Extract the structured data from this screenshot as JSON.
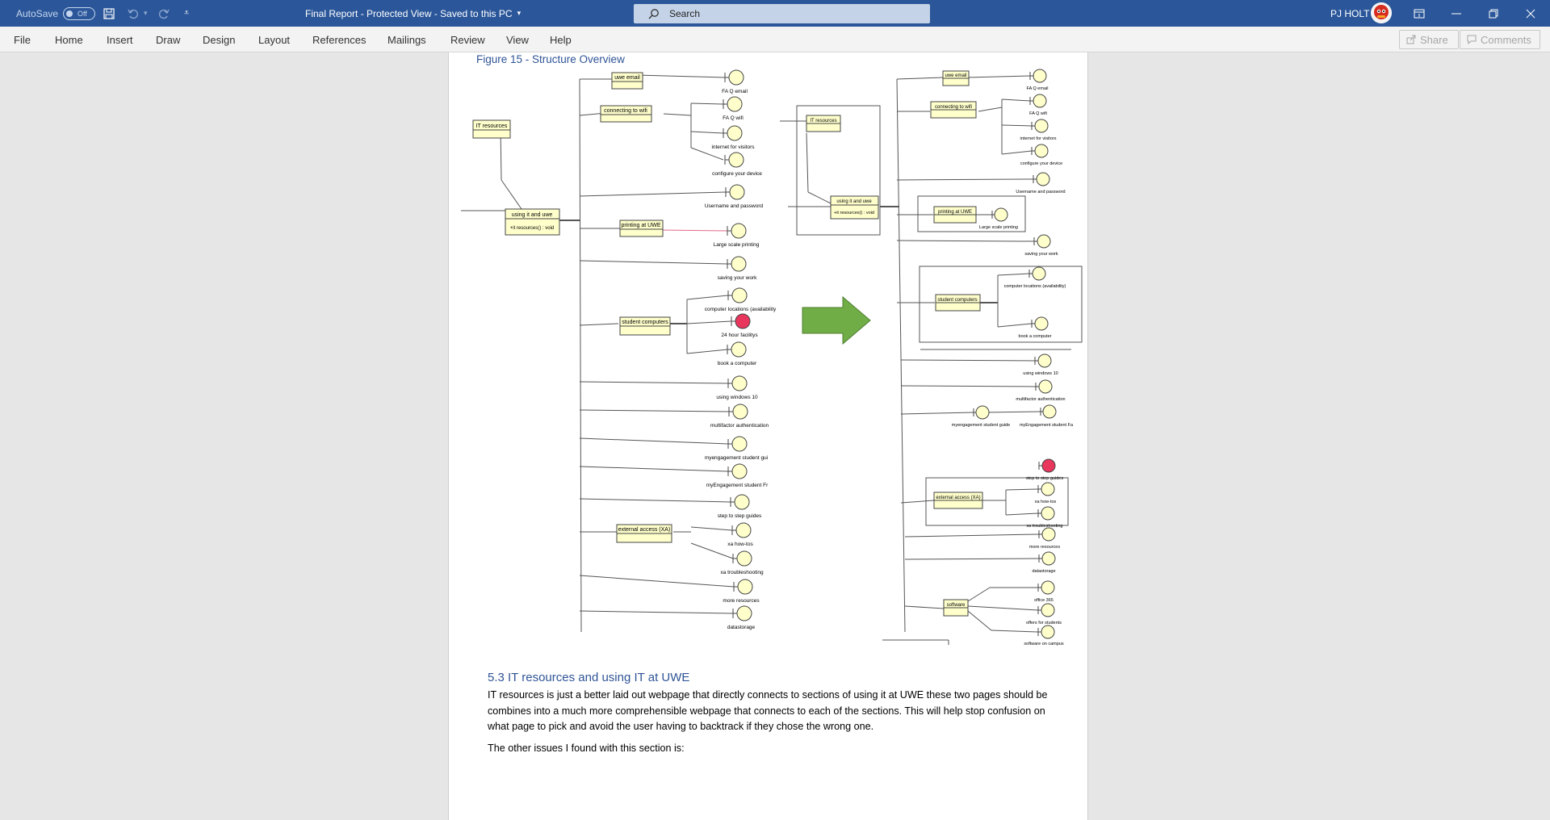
{
  "titlebar": {
    "autosave_label": "AutoSave",
    "autosave_state": "Off",
    "doc_title": "Final Report  -  Protected View  -  Saved to this PC",
    "search_placeholder": "Search",
    "user_name": "PJ HOLT"
  },
  "ribbon": {
    "tabs": [
      "File",
      "Home",
      "Insert",
      "Draw",
      "Design",
      "Layout",
      "References",
      "Mailings",
      "Review",
      "View",
      "Help"
    ],
    "share_label": "Share",
    "comments_label": "Comments"
  },
  "document": {
    "figure_caption": "Figure 15 - Structure Overview",
    "section_heading": "5.3 IT resources and using IT at UWE",
    "paragraph": "IT resources is just a better laid out webpage that directly connects to sections of using it at UWE these two pages should be combines into a much more comprehensible webpage that connects to each of the sections. This will help stop confusion on what page to pick and avoid the user having to backtrack if they chose the wrong one.",
    "paragraph2": "The other issues I found with this section is:"
  },
  "diagram_left": {
    "classes": [
      {
        "label": "uwe email"
      },
      {
        "label": "connecting to  wifi"
      },
      {
        "label": "IT resources"
      },
      {
        "label": "using it and uwe",
        "method": "+it resources() : void"
      },
      {
        "label": "printing at UWE"
      },
      {
        "label": "student computers"
      },
      {
        "label": "external access (XA)"
      }
    ],
    "nodes": [
      "FA Q email",
      "FA Q wifi",
      "internet for visitors",
      "configure your device",
      "Username and password",
      "Large scale printing",
      "saving your work",
      "computer locations (availability",
      "24 hour facilitys",
      "book a computer",
      "using windows 10",
      "multifactor authentication",
      "myengagement student gui",
      "myEngagement student Fr",
      "step to step guides",
      "xa how-tos",
      "xa troubleshooting",
      "more resources",
      "datastorage"
    ]
  },
  "diagram_right": {
    "classes": [
      {
        "label": "uwe email"
      },
      {
        "label": "connecting to  wifi"
      },
      {
        "label": "IT resources"
      },
      {
        "label": "using it and uwe",
        "method": "+it resources() : void"
      },
      {
        "label": "printing at UWE"
      },
      {
        "label": "student computers"
      },
      {
        "label": "external access (XA)"
      },
      {
        "label": "software"
      }
    ],
    "nodes": [
      "FA Q email",
      "FA Q wifi",
      "internet for visitors",
      "configure your device",
      "Username and password",
      "Large scale printing",
      "saving your work",
      "computer locations (availability)",
      "book a computer",
      "using windows 10",
      "multifactor authentication",
      "myengagement student guide",
      "myEngagement student Fa",
      "step to step guides",
      "xa how-tos",
      "xa troubleshooting",
      "more resources",
      "datastorage",
      "office 365",
      "offers for students",
      "software on campus"
    ]
  },
  "colors": {
    "title_bar": "#2b579a",
    "heading_blue": "#2f5496",
    "node_fill": "#ffffcc",
    "highlight_node": "#e8365d",
    "arrow_green": "#70ad47"
  }
}
